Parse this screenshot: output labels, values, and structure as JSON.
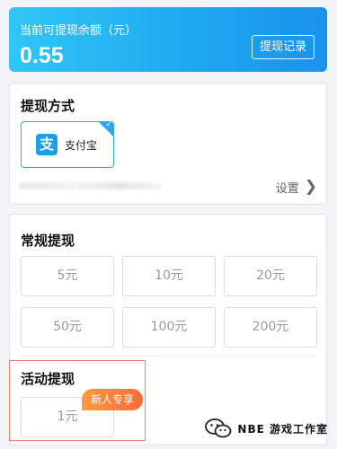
{
  "balance": {
    "label": "当前可提现余额（元）",
    "amount": "0.55",
    "record_button": "提现记录"
  },
  "withdraw_method": {
    "title": "提现方式",
    "option": {
      "label": "支付宝",
      "logo_char": "支",
      "selected": true
    },
    "settings_label": "设置"
  },
  "regular": {
    "title": "常规提现",
    "amounts": [
      "5元",
      "10元",
      "20元",
      "50元",
      "100元",
      "200元"
    ]
  },
  "activity": {
    "title": "活动提现",
    "amount": "1元",
    "badge": "新人专享"
  },
  "watermark": {
    "text": "NBE 游戏工作室"
  },
  "colors": {
    "banner_start": "#30c6f6",
    "banner_end": "#1992ec",
    "accent": "#2ba8f0",
    "badge": "#ff6b3a",
    "highlight_border": "#ef7a7a"
  }
}
